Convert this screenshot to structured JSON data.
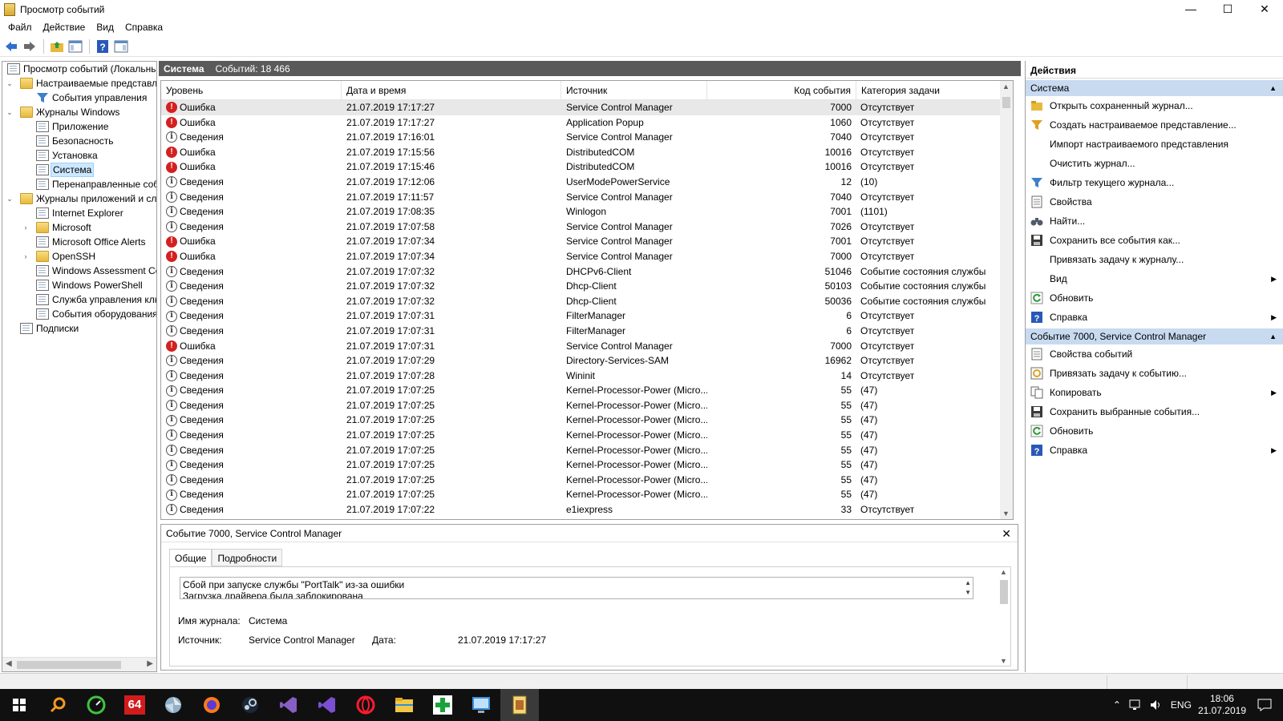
{
  "window": {
    "title": "Просмотр событий",
    "controls": [
      "—",
      "☐",
      "✕"
    ]
  },
  "menu": [
    "Файл",
    "Действие",
    "Вид",
    "Справка"
  ],
  "tree": [
    {
      "label": "Просмотр событий (Локальнь",
      "level": 0,
      "expander": "",
      "icon": "log"
    },
    {
      "label": "Настраиваемые представле",
      "level": 1,
      "expander": "⌄",
      "icon": "folder"
    },
    {
      "label": "События управления",
      "level": 2,
      "expander": "",
      "icon": "filter"
    },
    {
      "label": "Журналы Windows",
      "level": 1,
      "expander": "⌄",
      "icon": "folder"
    },
    {
      "label": "Приложение",
      "level": 2,
      "expander": "",
      "icon": "log"
    },
    {
      "label": "Безопасность",
      "level": 2,
      "expander": "",
      "icon": "log"
    },
    {
      "label": "Установка",
      "level": 2,
      "expander": "",
      "icon": "log"
    },
    {
      "label": "Система",
      "level": 2,
      "expander": "",
      "icon": "log",
      "selected": true
    },
    {
      "label": "Перенаправленные соб",
      "level": 2,
      "expander": "",
      "icon": "log"
    },
    {
      "label": "Журналы приложений и сл",
      "level": 1,
      "expander": "⌄",
      "icon": "folder"
    },
    {
      "label": "Internet Explorer",
      "level": 2,
      "expander": "",
      "icon": "log"
    },
    {
      "label": "Microsoft",
      "level": 2,
      "expander": "›",
      "icon": "folder"
    },
    {
      "label": "Microsoft Office Alerts",
      "level": 2,
      "expander": "",
      "icon": "log"
    },
    {
      "label": "OpenSSH",
      "level": 2,
      "expander": "›",
      "icon": "folder"
    },
    {
      "label": "Windows Assessment Co",
      "level": 2,
      "expander": "",
      "icon": "log"
    },
    {
      "label": "Windows PowerShell",
      "level": 2,
      "expander": "",
      "icon": "log"
    },
    {
      "label": "Служба управления клк",
      "level": 2,
      "expander": "",
      "icon": "log"
    },
    {
      "label": "События оборудования",
      "level": 2,
      "expander": "",
      "icon": "log"
    },
    {
      "label": "Подписки",
      "level": 1,
      "expander": "",
      "icon": "log"
    }
  ],
  "center": {
    "log_name": "Система",
    "count_label": "Событий: 18 466"
  },
  "grid": {
    "columns": [
      "Уровень",
      "Дата и время",
      "Источник",
      "Код события",
      "Категория задачи"
    ],
    "rows": [
      {
        "type": "err",
        "level": "Ошибка",
        "dt": "21.07.2019 17:17:27",
        "src": "Service Control Manager",
        "code": "7000",
        "cat": "Отсутствует",
        "selected": true
      },
      {
        "type": "err",
        "level": "Ошибка",
        "dt": "21.07.2019 17:17:27",
        "src": "Application Popup",
        "code": "1060",
        "cat": "Отсутствует"
      },
      {
        "type": "inf",
        "level": "Сведения",
        "dt": "21.07.2019 17:16:01",
        "src": "Service Control Manager",
        "code": "7040",
        "cat": "Отсутствует"
      },
      {
        "type": "err",
        "level": "Ошибка",
        "dt": "21.07.2019 17:15:56",
        "src": "DistributedCOM",
        "code": "10016",
        "cat": "Отсутствует"
      },
      {
        "type": "err",
        "level": "Ошибка",
        "dt": "21.07.2019 17:15:46",
        "src": "DistributedCOM",
        "code": "10016",
        "cat": "Отсутствует"
      },
      {
        "type": "inf",
        "level": "Сведения",
        "dt": "21.07.2019 17:12:06",
        "src": "UserModePowerService",
        "code": "12",
        "cat": "(10)"
      },
      {
        "type": "inf",
        "level": "Сведения",
        "dt": "21.07.2019 17:11:57",
        "src": "Service Control Manager",
        "code": "7040",
        "cat": "Отсутствует"
      },
      {
        "type": "inf",
        "level": "Сведения",
        "dt": "21.07.2019 17:08:35",
        "src": "Winlogon",
        "code": "7001",
        "cat": "(1101)"
      },
      {
        "type": "inf",
        "level": "Сведения",
        "dt": "21.07.2019 17:07:58",
        "src": "Service Control Manager",
        "code": "7026",
        "cat": "Отсутствует"
      },
      {
        "type": "err",
        "level": "Ошибка",
        "dt": "21.07.2019 17:07:34",
        "src": "Service Control Manager",
        "code": "7001",
        "cat": "Отсутствует"
      },
      {
        "type": "err",
        "level": "Ошибка",
        "dt": "21.07.2019 17:07:34",
        "src": "Service Control Manager",
        "code": "7000",
        "cat": "Отсутствует"
      },
      {
        "type": "inf",
        "level": "Сведения",
        "dt": "21.07.2019 17:07:32",
        "src": "DHCPv6-Client",
        "code": "51046",
        "cat": "Событие состояния службы"
      },
      {
        "type": "inf",
        "level": "Сведения",
        "dt": "21.07.2019 17:07:32",
        "src": "Dhcp-Client",
        "code": "50103",
        "cat": "Событие состояния службы"
      },
      {
        "type": "inf",
        "level": "Сведения",
        "dt": "21.07.2019 17:07:32",
        "src": "Dhcp-Client",
        "code": "50036",
        "cat": "Событие состояния службы"
      },
      {
        "type": "inf",
        "level": "Сведения",
        "dt": "21.07.2019 17:07:31",
        "src": "FilterManager",
        "code": "6",
        "cat": "Отсутствует"
      },
      {
        "type": "inf",
        "level": "Сведения",
        "dt": "21.07.2019 17:07:31",
        "src": "FilterManager",
        "code": "6",
        "cat": "Отсутствует"
      },
      {
        "type": "err",
        "level": "Ошибка",
        "dt": "21.07.2019 17:07:31",
        "src": "Service Control Manager",
        "code": "7000",
        "cat": "Отсутствует"
      },
      {
        "type": "inf",
        "level": "Сведения",
        "dt": "21.07.2019 17:07:29",
        "src": "Directory-Services-SAM",
        "code": "16962",
        "cat": "Отсутствует"
      },
      {
        "type": "inf",
        "level": "Сведения",
        "dt": "21.07.2019 17:07:28",
        "src": "Wininit",
        "code": "14",
        "cat": "Отсутствует"
      },
      {
        "type": "inf",
        "level": "Сведения",
        "dt": "21.07.2019 17:07:25",
        "src": "Kernel-Processor-Power (Micro...",
        "code": "55",
        "cat": "(47)"
      },
      {
        "type": "inf",
        "level": "Сведения",
        "dt": "21.07.2019 17:07:25",
        "src": "Kernel-Processor-Power (Micro...",
        "code": "55",
        "cat": "(47)"
      },
      {
        "type": "inf",
        "level": "Сведения",
        "dt": "21.07.2019 17:07:25",
        "src": "Kernel-Processor-Power (Micro...",
        "code": "55",
        "cat": "(47)"
      },
      {
        "type": "inf",
        "level": "Сведения",
        "dt": "21.07.2019 17:07:25",
        "src": "Kernel-Processor-Power (Micro...",
        "code": "55",
        "cat": "(47)"
      },
      {
        "type": "inf",
        "level": "Сведения",
        "dt": "21.07.2019 17:07:25",
        "src": "Kernel-Processor-Power (Micro...",
        "code": "55",
        "cat": "(47)"
      },
      {
        "type": "inf",
        "level": "Сведения",
        "dt": "21.07.2019 17:07:25",
        "src": "Kernel-Processor-Power (Micro...",
        "code": "55",
        "cat": "(47)"
      },
      {
        "type": "inf",
        "level": "Сведения",
        "dt": "21.07.2019 17:07:25",
        "src": "Kernel-Processor-Power (Micro...",
        "code": "55",
        "cat": "(47)"
      },
      {
        "type": "inf",
        "level": "Сведения",
        "dt": "21.07.2019 17:07:25",
        "src": "Kernel-Processor-Power (Micro...",
        "code": "55",
        "cat": "(47)"
      },
      {
        "type": "inf",
        "level": "Сведения",
        "dt": "21.07.2019 17:07:22",
        "src": "e1iexpress",
        "code": "33",
        "cat": "Отсутствует"
      }
    ]
  },
  "details": {
    "title": "Событие 7000, Service Control Manager",
    "close": "✕",
    "tabs": [
      "Общие",
      "Подробности"
    ],
    "message_line1": "Сбой при запуске службы \"PortTalk\" из-за ошибки",
    "message_line2": "Загрузка драйвера была заблокирована",
    "journal_label": "Имя журнала:",
    "journal_value": "Система",
    "source_label": "Источник:",
    "source_value": "Service Control Manager",
    "date_label": "Дата:",
    "date_value": "21.07.2019 17:17:27"
  },
  "actions": {
    "header": "Действия",
    "section1": "Система",
    "items1": [
      {
        "label": "Открыть сохраненный журнал...",
        "icon": "open-folder"
      },
      {
        "label": "Создать настраиваемое представление...",
        "icon": "filter-new"
      },
      {
        "label": "Импорт настраиваемого представления",
        "icon": ""
      },
      {
        "label": "Очистить журнал...",
        "icon": ""
      },
      {
        "label": "Фильтр текущего журнала...",
        "icon": "filter"
      },
      {
        "label": "Свойства",
        "icon": "properties"
      },
      {
        "label": "Найти...",
        "icon": "binoculars"
      },
      {
        "label": "Сохранить все события как...",
        "icon": "save"
      },
      {
        "label": "Привязать задачу к журналу...",
        "icon": ""
      },
      {
        "label": "Вид",
        "icon": "",
        "submenu": true
      },
      {
        "label": "Обновить",
        "icon": "refresh"
      },
      {
        "label": "Справка",
        "icon": "help",
        "submenu": true
      }
    ],
    "section2": "Событие 7000, Service Control Manager",
    "items2": [
      {
        "label": "Свойства событий",
        "icon": "properties"
      },
      {
        "label": "Привязать задачу к событию...",
        "icon": "task"
      },
      {
        "label": "Копировать",
        "icon": "copy",
        "submenu": true
      },
      {
        "label": "Сохранить выбранные события...",
        "icon": "save"
      },
      {
        "label": "Обновить",
        "icon": "refresh"
      },
      {
        "label": "Справка",
        "icon": "help",
        "submenu": true
      }
    ]
  },
  "taskbar": {
    "items": [
      "start",
      "search",
      "speed-meter",
      "aida64",
      "pinwheel",
      "firefox",
      "steam",
      "visual-studio-2",
      "visual-studio",
      "opera",
      "file-explorer",
      "medical-plus",
      "remote-desktop",
      "event-viewer"
    ],
    "aida_text": "64",
    "lang": "ENG",
    "time": "18:06",
    "date": "21.07.2019"
  },
  "colors": {
    "accent_bar": "#5a5a5a",
    "section": "#c7daf0",
    "error": "#d42020",
    "taskbar": "#101010"
  }
}
